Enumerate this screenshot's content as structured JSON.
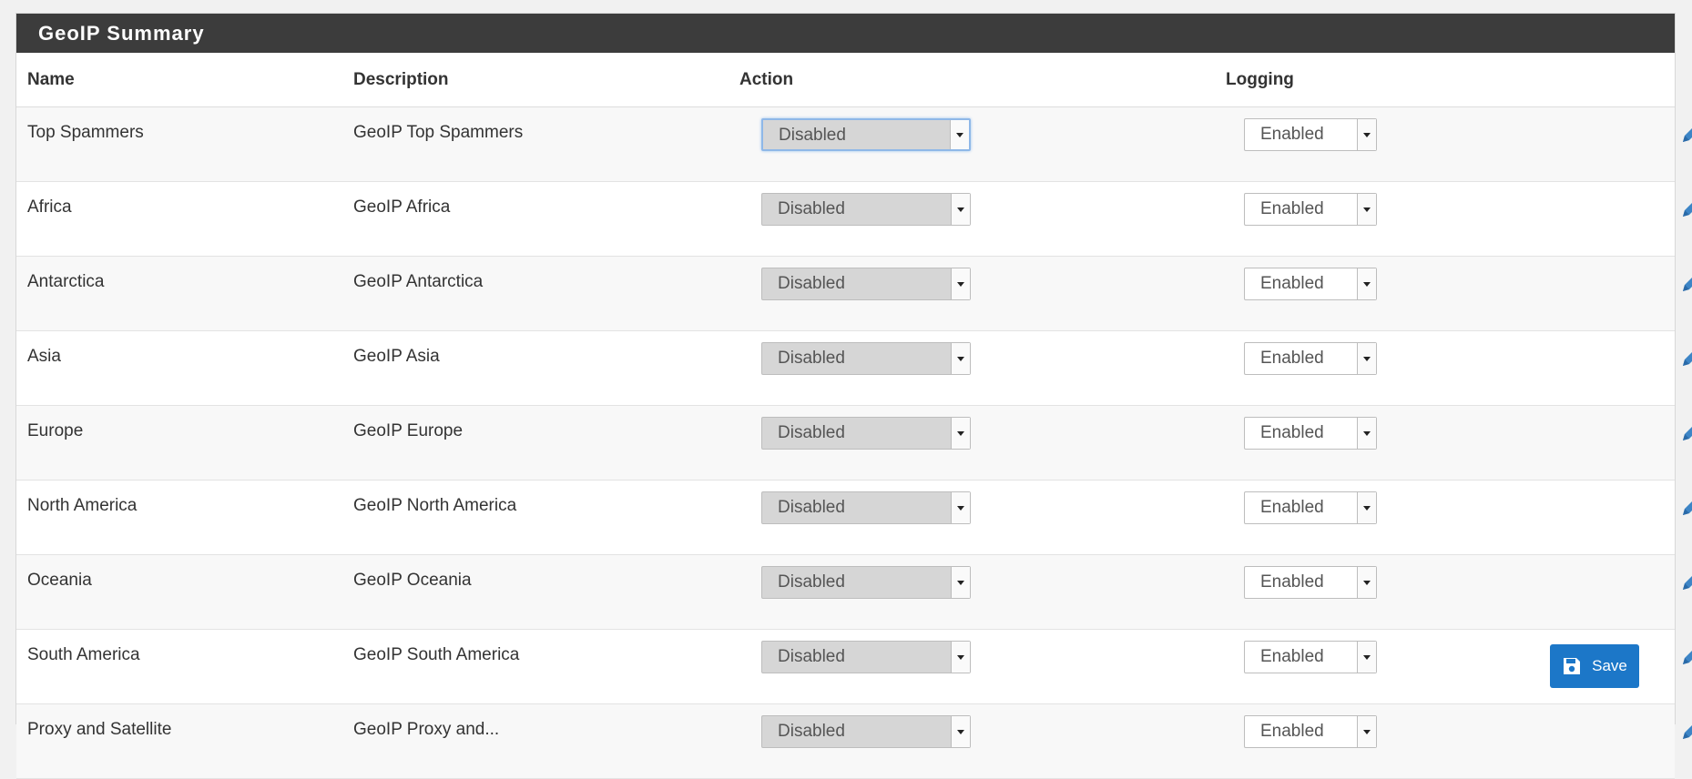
{
  "panel": {
    "title": "GeoIP Summary"
  },
  "table": {
    "headers": {
      "name": "Name",
      "description": "Description",
      "action": "Action",
      "logging": "Logging"
    },
    "rows": [
      {
        "name": "Top Spammers",
        "description": "GeoIP Top Spammers",
        "action": "Disabled",
        "logging": "Enabled"
      },
      {
        "name": "Africa",
        "description": "GeoIP Africa",
        "action": "Disabled",
        "logging": "Enabled"
      },
      {
        "name": "Antarctica",
        "description": "GeoIP Antarctica",
        "action": "Disabled",
        "logging": "Enabled"
      },
      {
        "name": "Asia",
        "description": "GeoIP Asia",
        "action": "Disabled",
        "logging": "Enabled"
      },
      {
        "name": "Europe",
        "description": "GeoIP Europe",
        "action": "Disabled",
        "logging": "Enabled"
      },
      {
        "name": "North America",
        "description": "GeoIP North America",
        "action": "Disabled",
        "logging": "Enabled"
      },
      {
        "name": "Oceania",
        "description": "GeoIP Oceania",
        "action": "Disabled",
        "logging": "Enabled"
      },
      {
        "name": "South America",
        "description": "GeoIP South America",
        "action": "Disabled",
        "logging": "Enabled"
      },
      {
        "name": "Proxy and Satellite",
        "description": "GeoIP Proxy and...",
        "action": "Disabled",
        "logging": "Enabled"
      }
    ]
  },
  "icons": {
    "edit": "pencil-icon",
    "save": "floppy-disk-icon"
  },
  "footer": {
    "save_label": "Save"
  },
  "colors": {
    "header_bar": "#3c3c3c",
    "accent": "#1c77c8"
  }
}
